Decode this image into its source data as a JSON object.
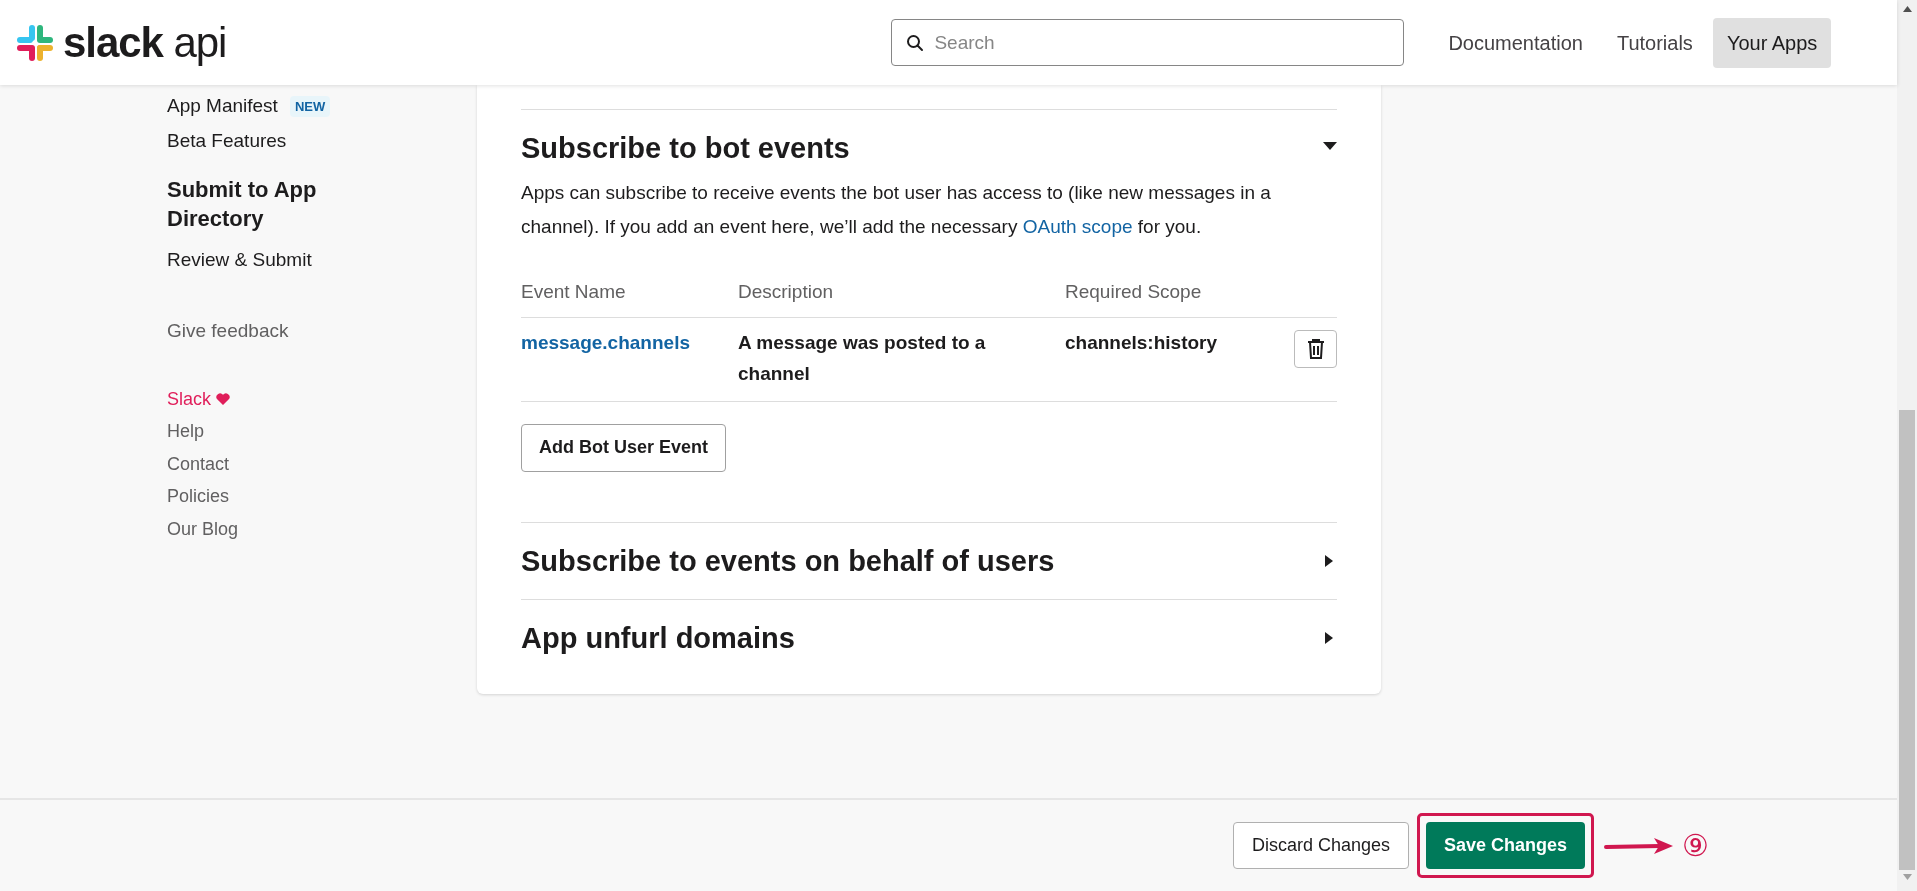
{
  "header": {
    "logo_text": "**slack** api",
    "search": {
      "placeholder": "Search"
    },
    "nav": [
      {
        "label": "Documentation",
        "selected": false
      },
      {
        "label": "Tutorials",
        "selected": false
      },
      {
        "label": "Your Apps",
        "selected": true
      }
    ]
  },
  "sidebar": {
    "items": [
      {
        "kind": "link",
        "label": "App Manifest",
        "badge": "NEW"
      },
      {
        "kind": "link",
        "label": "Beta Features"
      },
      {
        "kind": "heading",
        "label": "Submit to App Directory"
      },
      {
        "kind": "link",
        "label": "Review & Submit"
      },
      {
        "kind": "muted",
        "label": "Give feedback"
      }
    ],
    "footer_links": [
      {
        "kind": "brand",
        "label": "Slack"
      },
      {
        "kind": "link",
        "label": "Help"
      },
      {
        "kind": "link",
        "label": "Contact"
      },
      {
        "kind": "link",
        "label": "Policies"
      },
      {
        "kind": "link",
        "label": "Our Blog"
      }
    ]
  },
  "sections": [
    {
      "title": "Subscribe to bot events",
      "expanded": true,
      "description": [
        {
          "kind": "text",
          "text": "Apps can subscribe to receive events the bot user has access to (like new messages in a channel). If you add an event here, we’ll add the necessary "
        },
        {
          "kind": "link",
          "text": "OAuth scope"
        },
        {
          "kind": "text",
          "text": " for you."
        }
      ],
      "table": {
        "columns": [
          "Event Name",
          "Description",
          "Required Scope"
        ],
        "rows": [
          {
            "event_name": "message.channels",
            "description": "A message was posted to a channel",
            "required_scope": "channels:history"
          }
        ]
      },
      "button": "Add Bot User Event"
    },
    {
      "title": "Subscribe to events on behalf of users",
      "expanded": false
    },
    {
      "title": "App unfurl domains",
      "expanded": false
    }
  ],
  "footer_bar": {
    "buttons": [
      {
        "kind": "secondary",
        "label": "Discard Changes",
        "highlighted": false
      },
      {
        "kind": "primary",
        "label": "Save Changes",
        "highlighted": true
      }
    ],
    "annotation": {
      "label": "⑨"
    }
  }
}
